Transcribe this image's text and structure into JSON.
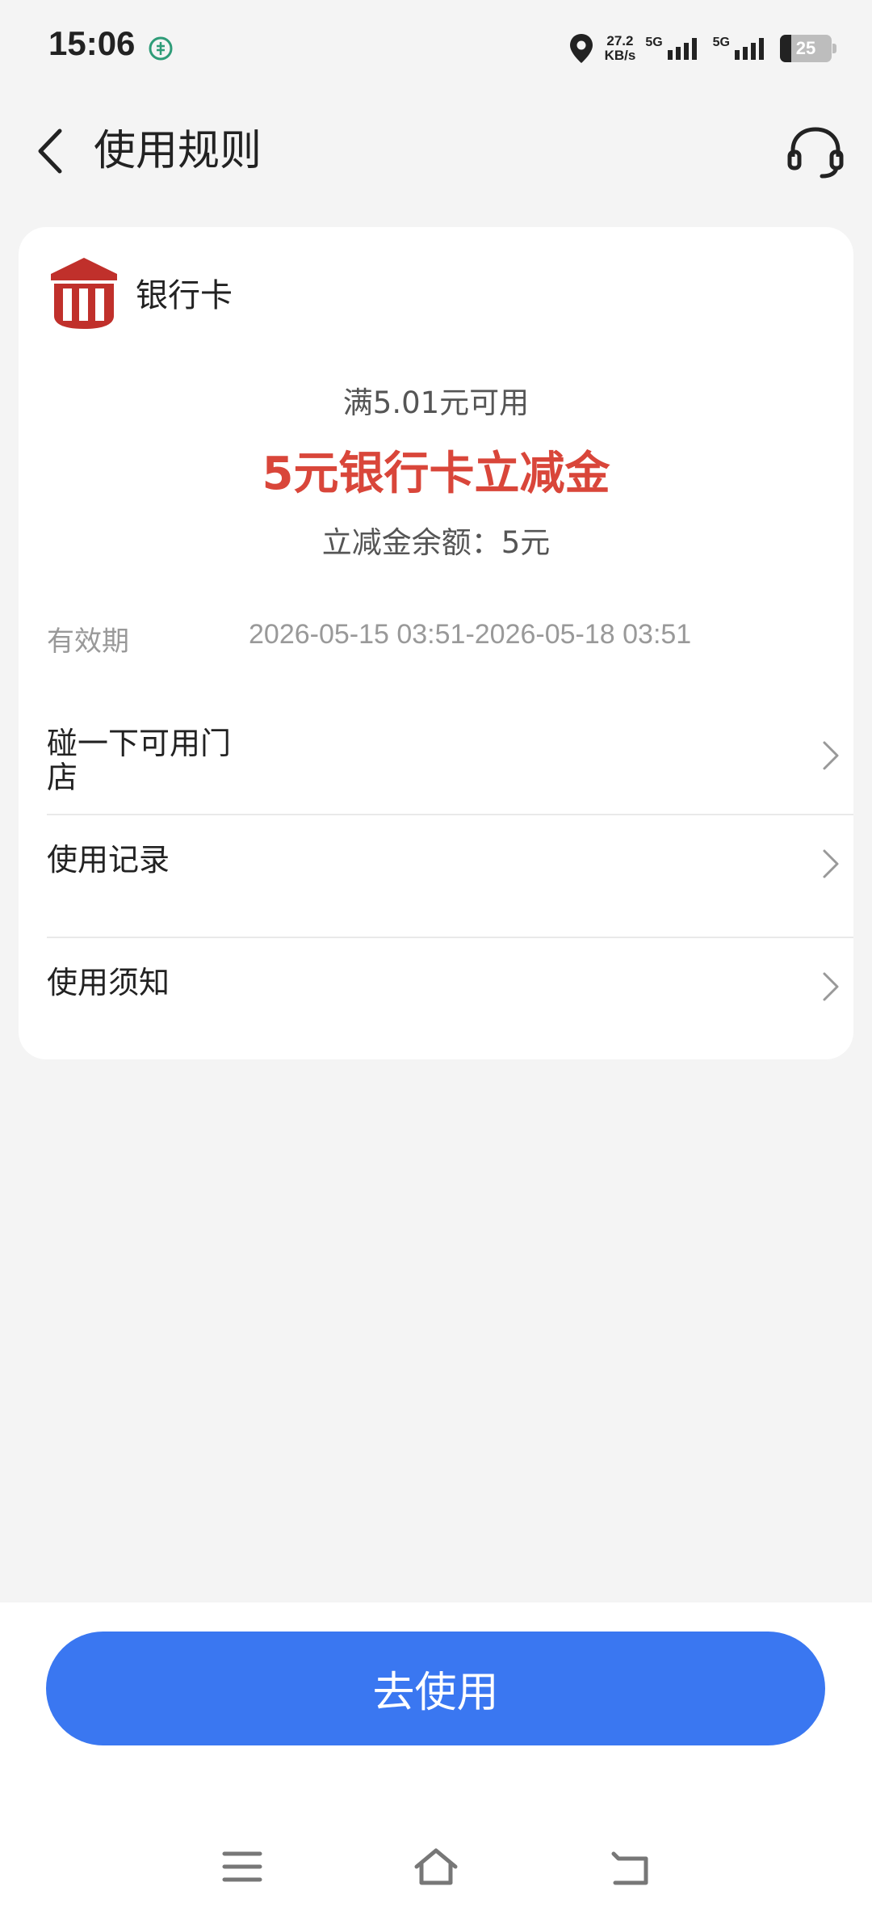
{
  "status_bar": {
    "time": "15:06",
    "speed_value": "27.2",
    "speed_unit": "KB/s",
    "sim1_label": "5G",
    "sim2_label": "5G",
    "battery": "25"
  },
  "header": {
    "title": "使用规则"
  },
  "card": {
    "bank_name": "银行卡",
    "condition": "满5.01元可用",
    "coupon_title": "5元银行卡立减金",
    "balance": "立减金余额：5元",
    "validity_label": "有效期",
    "validity_value": "2026-05-15 03:51-2026-05-18 03:51",
    "rows": [
      {
        "label_line1": "碰一下可用门",
        "label_line2": "店"
      },
      {
        "label_line1": "使用记录",
        "label_line2": ""
      },
      {
        "label_line1": "使用须知",
        "label_line2": ""
      }
    ]
  },
  "action": {
    "go_label": "去使用"
  },
  "colors": {
    "accent_blue": "#3a77f1",
    "coupon_red": "#d9463a",
    "bank_logo_red": "#c0302b"
  },
  "icons": {
    "back": "chevron-left-icon",
    "customer_service": "headset-icon",
    "bank": "bank-building-icon",
    "row_arrow": "chevron-right-icon",
    "nav_menu": "menu-icon",
    "nav_home": "home-icon",
    "nav_back": "return-icon"
  }
}
